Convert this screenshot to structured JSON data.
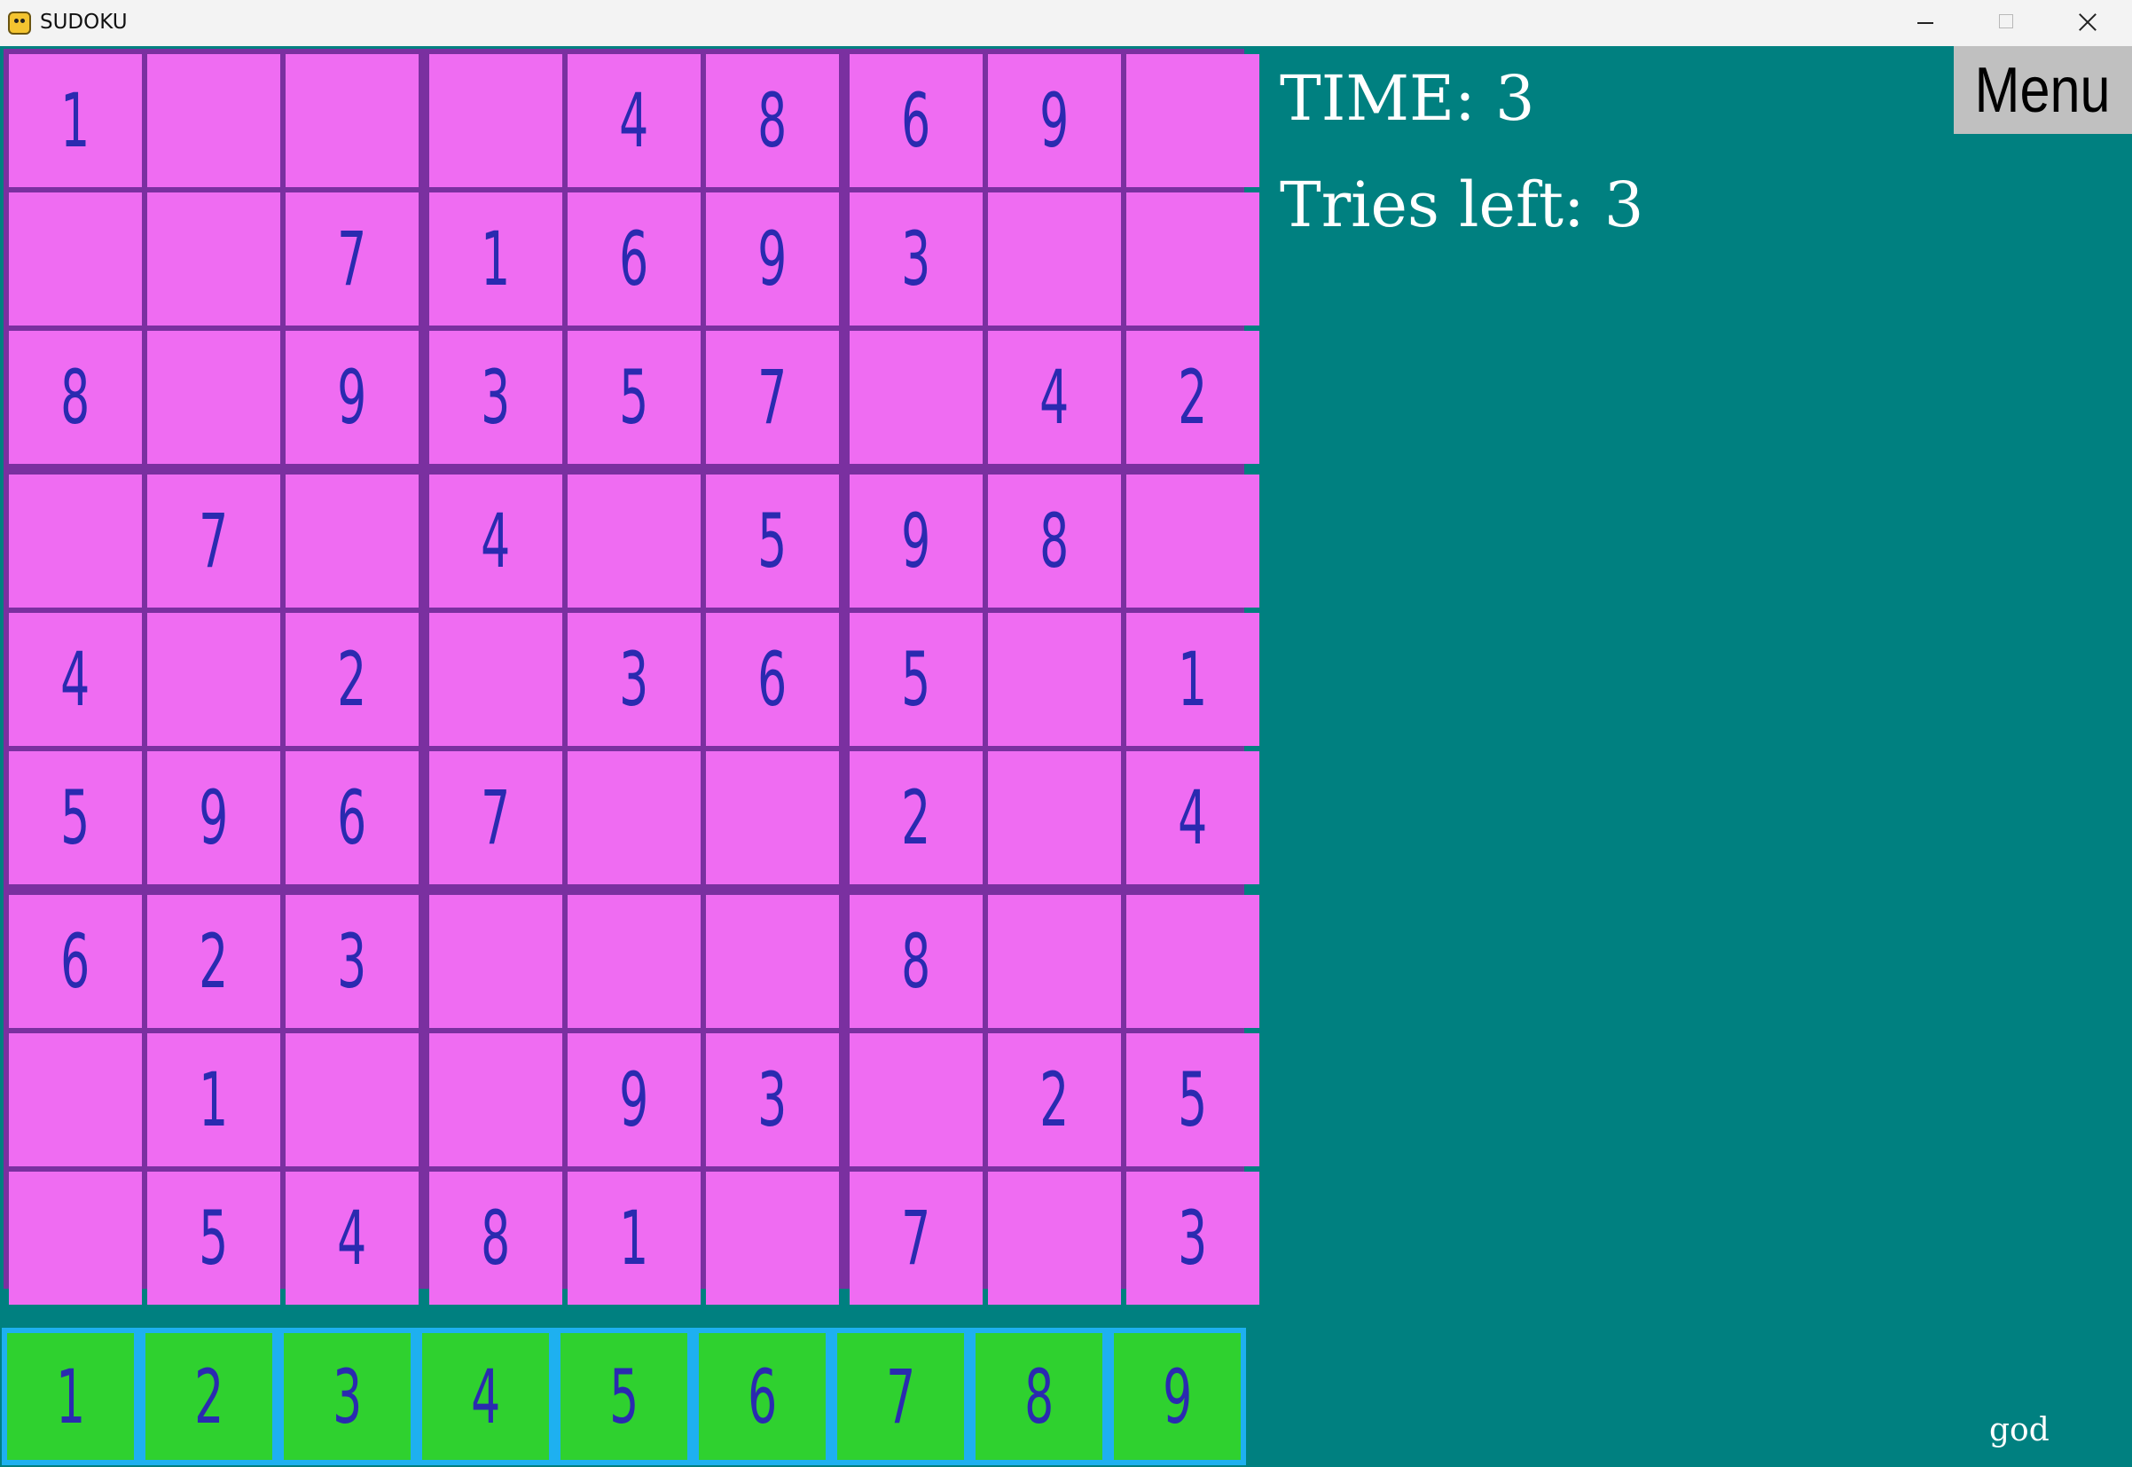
{
  "window": {
    "title": "SUDOKU",
    "app_icon": "pygame-snake-icon",
    "controls": [
      "minimize-icon",
      "maximize-icon",
      "close-icon"
    ]
  },
  "board": {
    "cells": [
      [
        "1",
        "",
        "",
        "",
        "4",
        "8",
        "6",
        "9",
        ""
      ],
      [
        "",
        "",
        "7",
        "1",
        "6",
        "9",
        "3",
        "",
        ""
      ],
      [
        "8",
        "",
        "9",
        "3",
        "5",
        "7",
        "",
        "4",
        "2"
      ],
      [
        "",
        "7",
        "",
        "4",
        "",
        "5",
        "9",
        "8",
        ""
      ],
      [
        "4",
        "",
        "2",
        "",
        "3",
        "6",
        "5",
        "",
        "1"
      ],
      [
        "5",
        "9",
        "6",
        "7",
        "",
        "",
        "2",
        "",
        "4"
      ],
      [
        "6",
        "2",
        "3",
        "",
        "",
        "",
        "8",
        "",
        ""
      ],
      [
        "",
        "1",
        "",
        "",
        "9",
        "3",
        "",
        "2",
        "5"
      ],
      [
        "",
        "5",
        "4",
        "8",
        "1",
        "",
        "7",
        "",
        "3"
      ]
    ]
  },
  "number_pad": [
    "1",
    "2",
    "3",
    "4",
    "5",
    "6",
    "7",
    "8",
    "9"
  ],
  "status": {
    "time": "TIME: 3",
    "tries": "Tries left: 3"
  },
  "menu": {
    "label": "Menu"
  },
  "footer": {
    "text": "god"
  },
  "colors": {
    "background": "#008080",
    "cell": "#ef6cf2",
    "grid_lines": "#7a30a0",
    "digits": "#2a2ab0",
    "pad_key": "#2fd12f",
    "pad_border": "#1eb0f0",
    "menu_button": "#c0c0c0"
  }
}
